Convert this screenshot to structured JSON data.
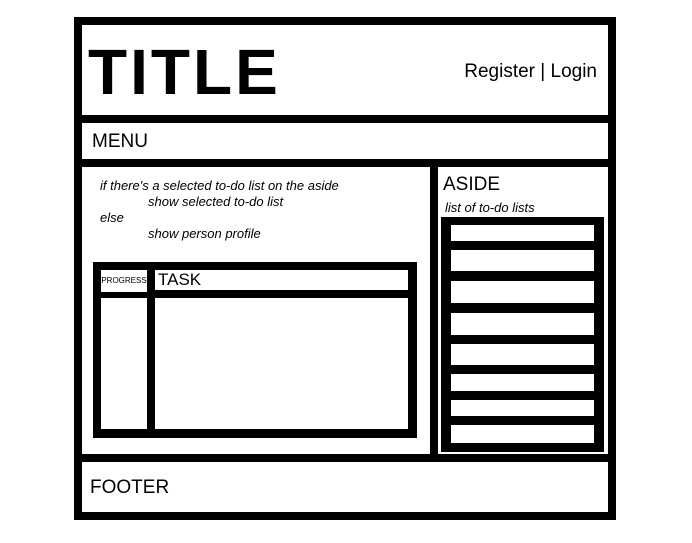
{
  "header": {
    "title": "TITLE",
    "register_label": "Register",
    "separator": "|",
    "login_label": "Login"
  },
  "menu": {
    "label": "MENU"
  },
  "main": {
    "pseudocode": [
      "if there's a selected to-do list on the aside",
      "show selected to-do list",
      "else",
      "show person profile"
    ],
    "table": {
      "progress_header": "PROGRESS",
      "task_header": "TASK"
    }
  },
  "aside": {
    "title": "ASIDE",
    "subtitle": "list of to-do lists",
    "item_count": 8
  },
  "footer": {
    "label": "FOOTER"
  }
}
